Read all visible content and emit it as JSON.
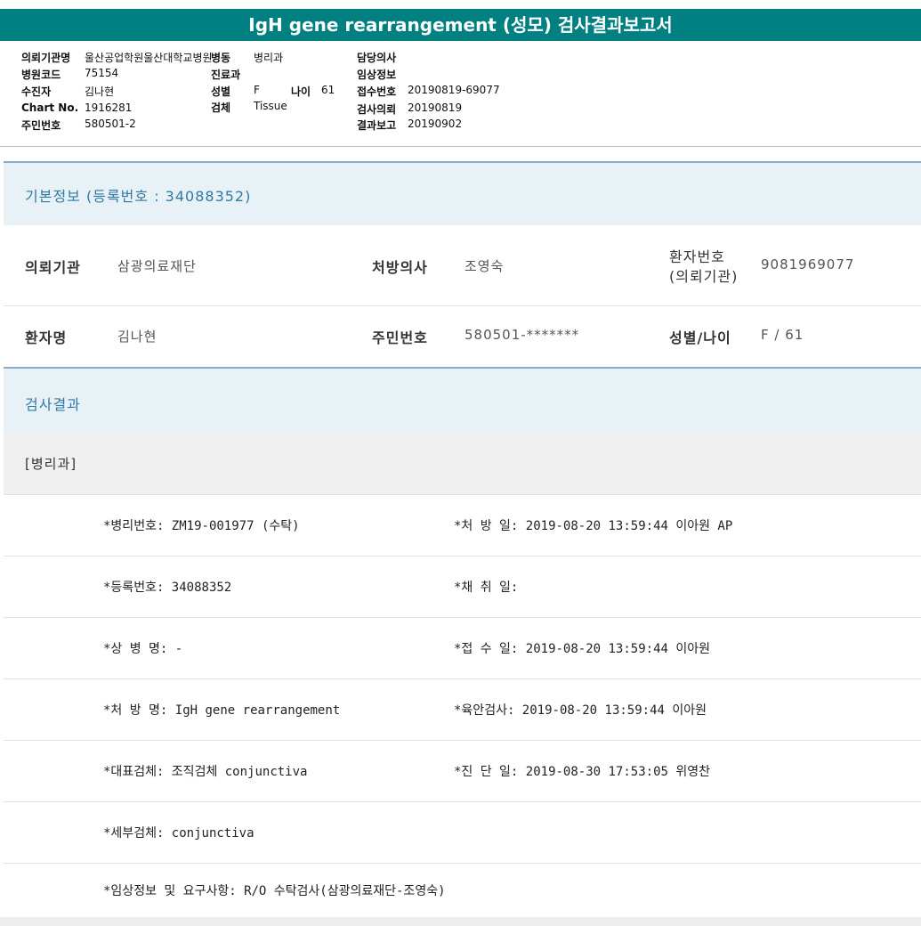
{
  "title": "IgH gene rearrangement (성모) 검사결과보고서",
  "header": {
    "institution_label": "의뢰기관명",
    "institution_value": "울산공업학원울산대학교병원",
    "ward_label": "병동",
    "ward_value": "병리과",
    "attending_label": "담당의사",
    "hospital_code_label": "병원코드",
    "hospital_code_value": "75154",
    "dept_label": "진료과",
    "clinical_label": "임상정보",
    "patient_label": "수진자",
    "patient_value": "김나현",
    "sex_label": "성별",
    "sex_value": "F",
    "age_label": "나이",
    "age_value": "61",
    "receipt_label": "접수번호",
    "receipt_value": "20190819-69077",
    "chart_label": "Chart No.",
    "chart_value": "1916281",
    "specimen_label": "검체",
    "specimen_value": "Tissue",
    "request_label": "검사의뢰",
    "request_value": "20190819",
    "resident_label": "주민번호",
    "resident_value": "580501-2",
    "report_label": "결과보고",
    "report_value": "20190902"
  },
  "basic": {
    "title": "기본정보",
    "reg_text": "(등록번호 : 34088352)"
  },
  "row1": {
    "k1": "의뢰기관",
    "v1": "삼광의료재단",
    "k2": "처방의사",
    "v2": "조영숙",
    "k3a": "환자번호",
    "k3b": "(의뢰기관)",
    "v3": "9081969077"
  },
  "row2": {
    "k1": "환자명",
    "v1": "김나현",
    "k2": "주민번호",
    "v2": "580501-*******",
    "k3": "성별/나이",
    "v3": "F / 61"
  },
  "results": {
    "title": "검사결과",
    "dept": "[병리과]",
    "lines": [
      {
        "left": "*병리번호: ZM19-001977 (수탁)",
        "right": "*처 방 일: 2019-08-20 13:59:44  이아원 AP"
      },
      {
        "left": "*등록번호: 34088352",
        "right": "*채 취 일:"
      },
      {
        "left": "*상 병 명: -",
        "right": "*접 수 일: 2019-08-20 13:59:44  이아원"
      },
      {
        "left": "*처 방 명: IgH gene rearrangement",
        "right": "*육안검사: 2019-08-20 13:59:44  이아원"
      },
      {
        "left": "*대표검체: 조직검체 conjunctiva",
        "right": "*진 단 일: 2019-08-30 17:53:05  위영찬"
      },
      {
        "left": "*세부검체: conjunctiva",
        "right": ""
      },
      {
        "left": "*임상정보 및 요구사항: R/O 수탁검사(삼광의료재단-조영숙)",
        "right": ""
      }
    ]
  }
}
